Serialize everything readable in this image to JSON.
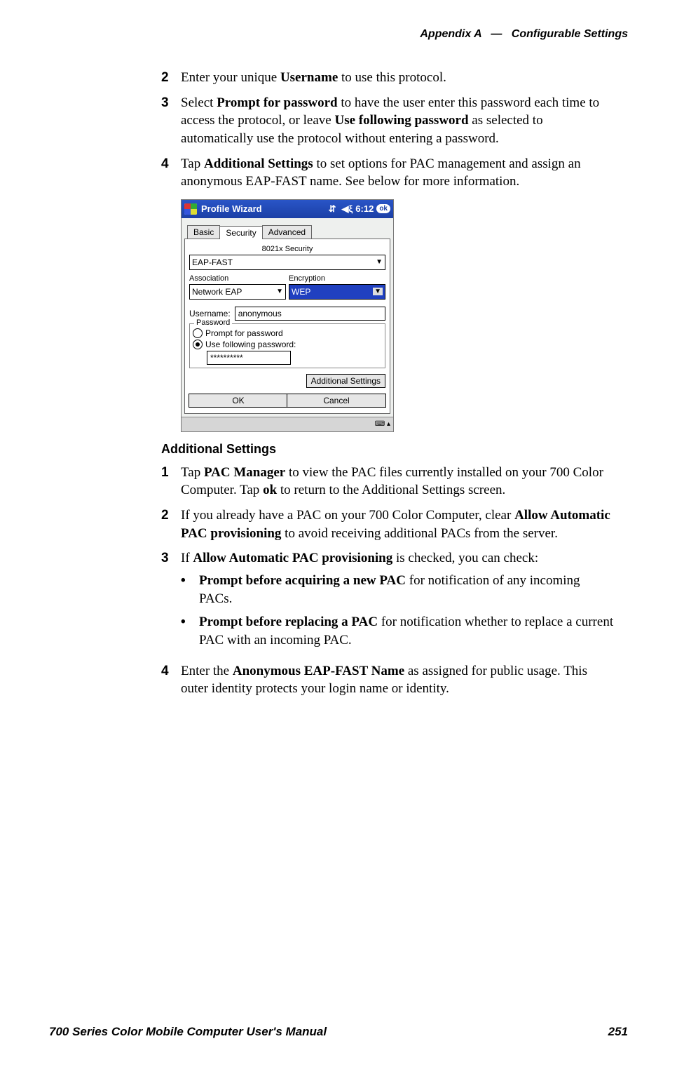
{
  "header": {
    "appendix": "Appendix A",
    "dash": "—",
    "section": "Configurable Settings"
  },
  "steps_top": [
    {
      "num": "2",
      "parts": [
        "Enter your unique ",
        "Username",
        " to use this protocol."
      ]
    },
    {
      "num": "3",
      "parts": [
        "Select ",
        "Prompt for password",
        " to have the user enter this password each time to access the protocol, or leave ",
        "Use following password",
        " as selected to automatically use the protocol without entering a password."
      ]
    },
    {
      "num": "4",
      "parts": [
        "Tap ",
        "Additional Settings",
        " to set options for PAC management and assign an anonymous EAP-FAST name. See below for more information."
      ]
    }
  ],
  "screenshot": {
    "title": "Profile Wizard",
    "time": "6:12",
    "ok": "ok",
    "tabs": {
      "basic": "Basic",
      "security": "Security",
      "advanced": "Advanced"
    },
    "label_8021x": "8021x Security",
    "combo_8021x": "EAP-FAST",
    "label_assoc": "Association",
    "combo_assoc": "Network EAP",
    "label_enc": "Encryption",
    "combo_enc": "WEP",
    "username_label": "Username:",
    "username_value": "anonymous",
    "group_title": "Password",
    "radio_prompt": "Prompt for password",
    "radio_use": "Use following password:",
    "password_value": "**********",
    "btn_additional": "Additional Settings",
    "btn_ok": "OK",
    "btn_cancel": "Cancel"
  },
  "subhead": "Additional Settings",
  "steps_bottom": [
    {
      "num": "1",
      "parts": [
        "Tap ",
        "PAC Manager",
        " to view the PAC files currently installed on your 700 Color Computer. Tap ",
        "ok",
        " to return to the Additional Settings screen."
      ]
    },
    {
      "num": "2",
      "parts": [
        "If you already have a PAC on your 700 Color Computer, clear ",
        "Allow Automatic PAC provisioning",
        " to avoid receiving additional PACs from the server."
      ]
    },
    {
      "num": "3",
      "parts": [
        "If ",
        "Allow Automatic PAC provisioning",
        " is checked, you can check:"
      ]
    },
    {
      "num": "4",
      "parts": [
        "Enter the ",
        "Anonymous EAP-FAST Name",
        " as assigned for public usage. This outer identity protects your login name or identity."
      ]
    }
  ],
  "bullets": [
    {
      "parts": [
        "Prompt before acquiring a new PAC",
        " for notification of any incoming PACs."
      ]
    },
    {
      "parts": [
        "Prompt before replacing a PAC",
        " for notification whether to replace a current PAC with an incoming PAC."
      ]
    }
  ],
  "footer": {
    "left": "700 Series Color Mobile Computer User's Manual",
    "right": "251"
  }
}
